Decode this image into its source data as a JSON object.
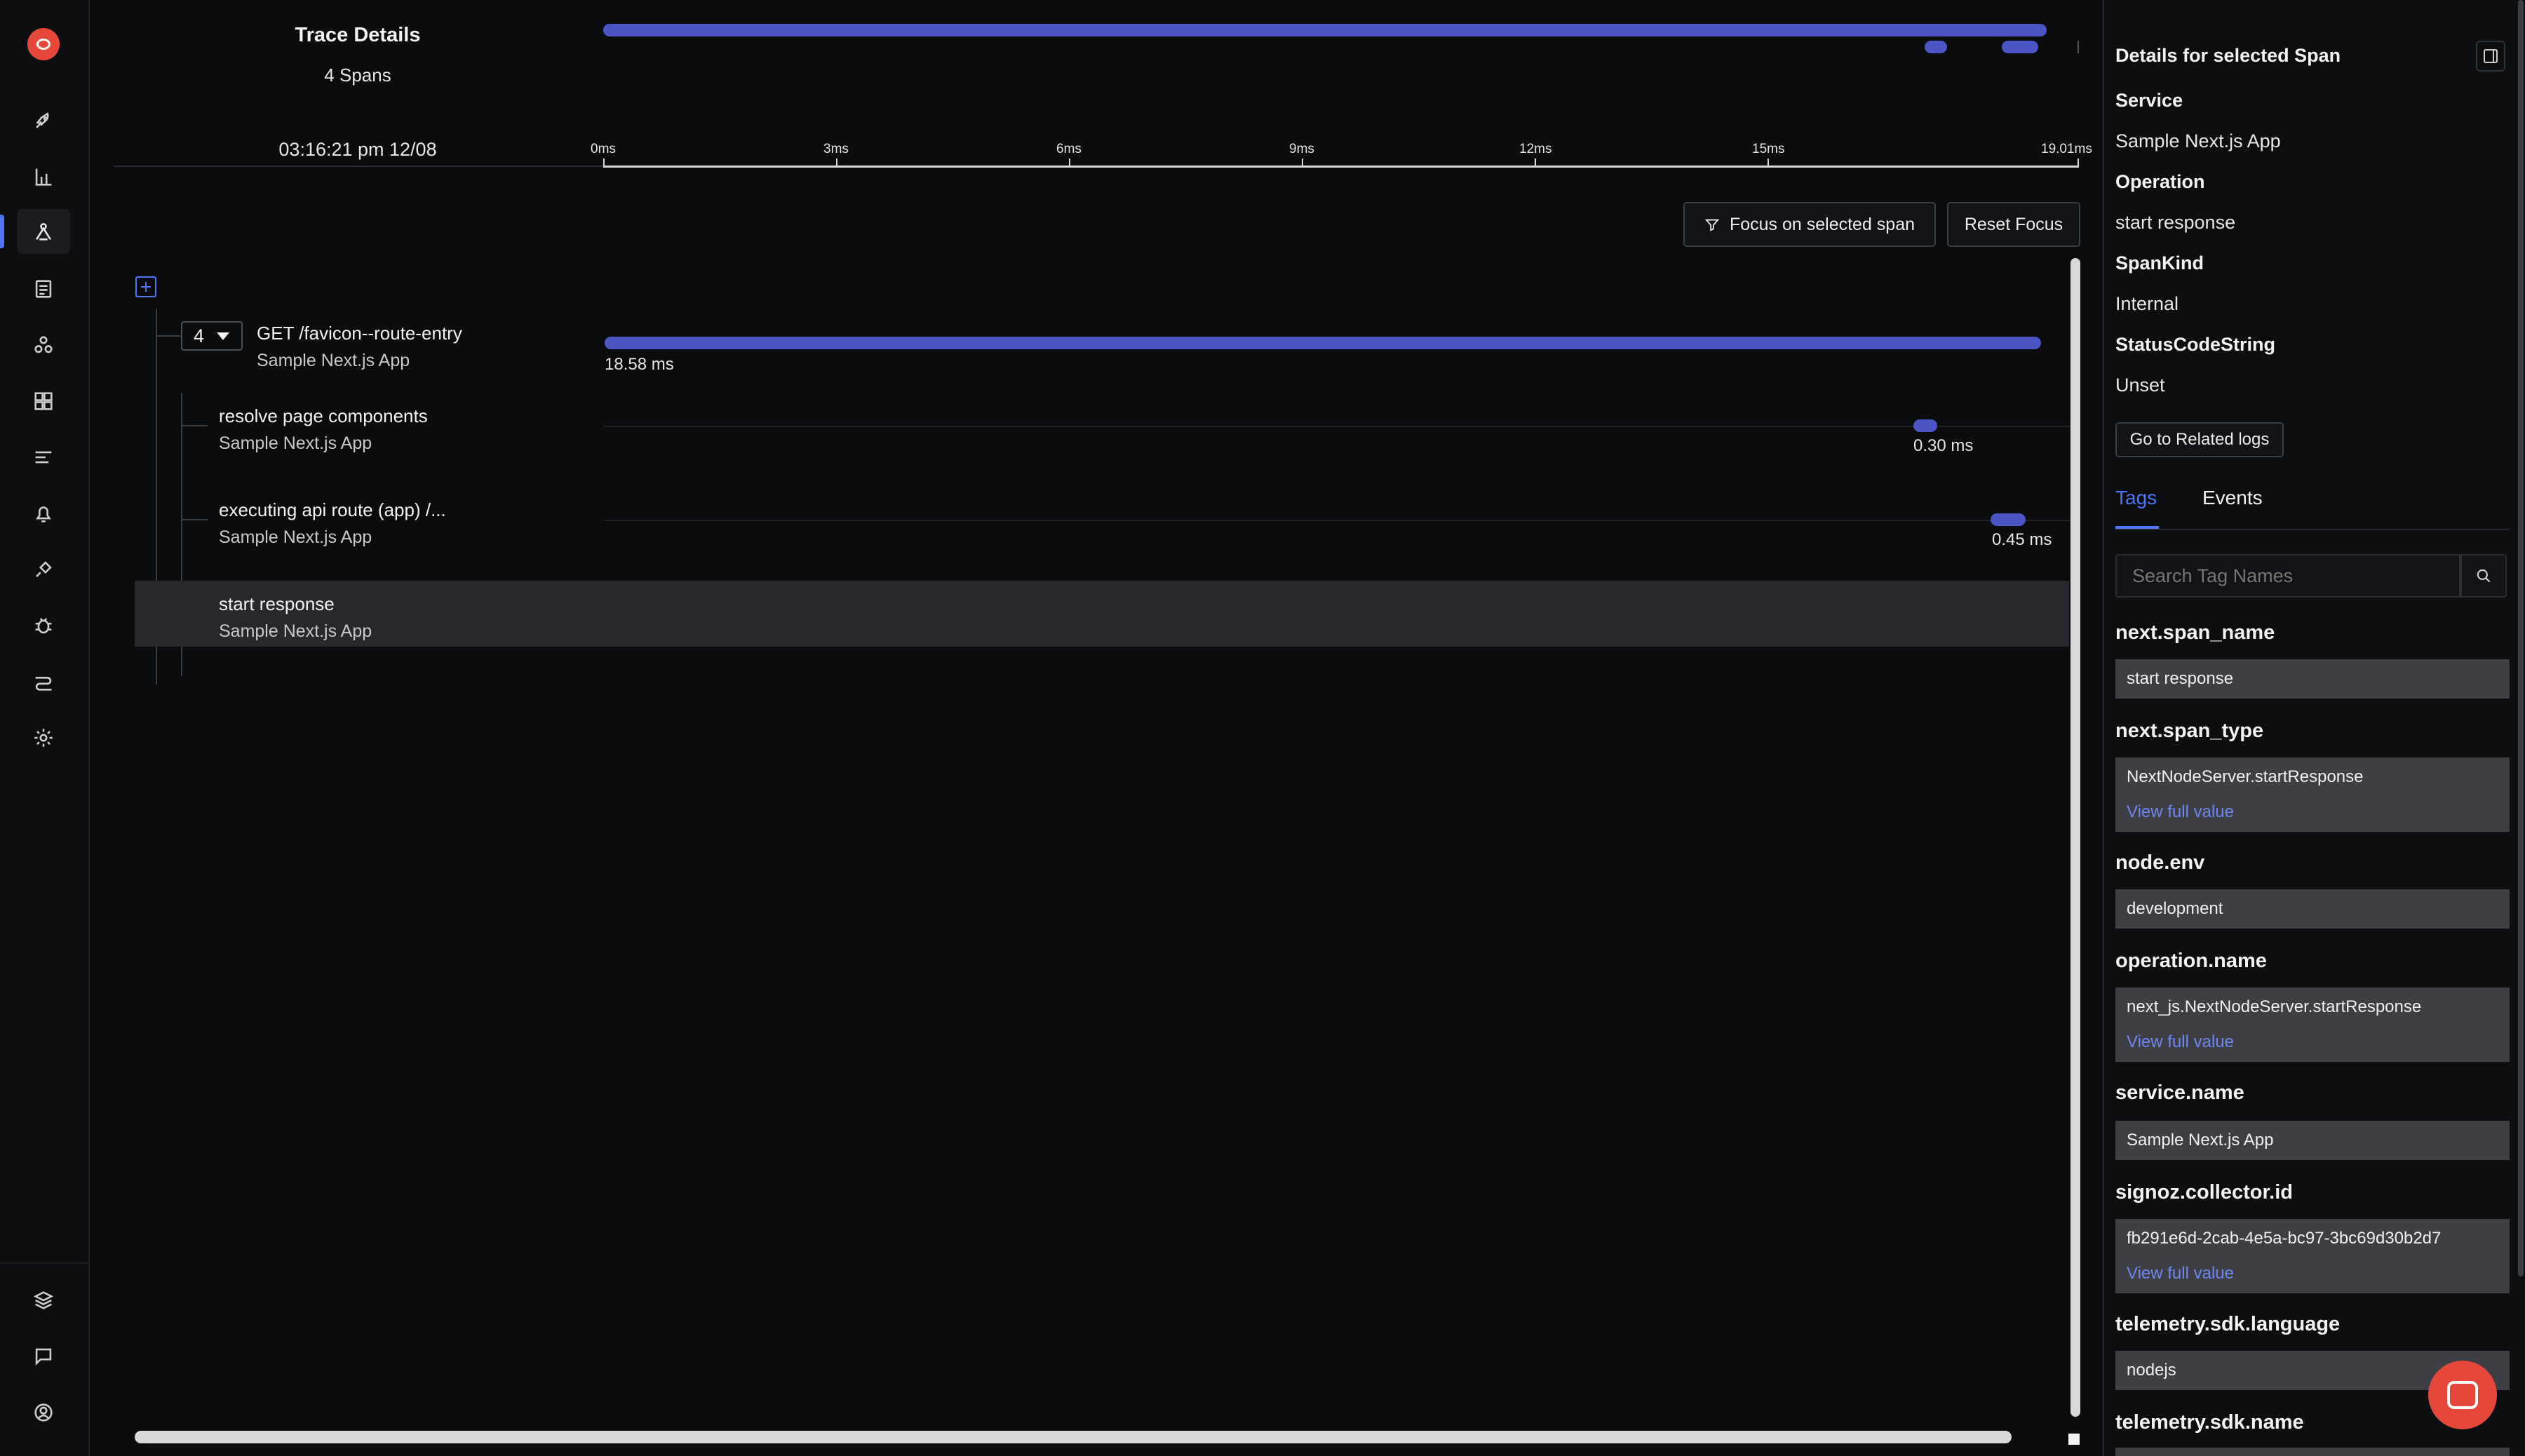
{
  "trace": {
    "title": "Trace Details",
    "span_count": "4 Spans",
    "timestamp": "03:16:21 pm 12/08",
    "ticks": [
      "0ms",
      "3ms",
      "6ms",
      "9ms",
      "12ms",
      "15ms",
      "19.01ms"
    ]
  },
  "controls": {
    "focus_label": "Focus on selected span",
    "reset_label": "Reset Focus"
  },
  "tree": {
    "child_count": "4",
    "spans": [
      {
        "name": "GET /favicon--route-entry",
        "service": "Sample Next.js App",
        "duration": "18.58 ms"
      },
      {
        "name": "resolve page components",
        "service": "Sample Next.js App",
        "duration": "0.30 ms"
      },
      {
        "name": "executing api route (app) /...",
        "service": "Sample Next.js App",
        "duration": "0.45 ms"
      },
      {
        "name": "start response",
        "service": "Sample Next.js App",
        "duration": ""
      }
    ]
  },
  "details": {
    "heading": "Details for selected Span",
    "fields": [
      {
        "label": "Service",
        "value": "Sample Next.js App"
      },
      {
        "label": "Operation",
        "value": "start response"
      },
      {
        "label": "SpanKind",
        "value": "Internal"
      },
      {
        "label": "StatusCodeString",
        "value": "Unset"
      }
    ],
    "related_logs_label": "Go to Related logs",
    "tabs": [
      "Tags",
      "Events"
    ],
    "active_tab": "Tags",
    "search_placeholder": "Search Tag Names",
    "view_full_label": "View full value",
    "tags": [
      {
        "key": "next.span_name",
        "value": "start response"
      },
      {
        "key": "next.span_type",
        "value": "NextNodeServer.startResponse"
      },
      {
        "key": "node.env",
        "value": "development"
      },
      {
        "key": "operation.name",
        "value": "next_js.NextNodeServer.startResponse"
      },
      {
        "key": "service.name",
        "value": "Sample Next.js App"
      },
      {
        "key": "signoz.collector.id",
        "value": "fb291e6d-2cab-4e5a-bc97-3bc69d30b2d7"
      },
      {
        "key": "telemetry.sdk.language",
        "value": "nodejs"
      },
      {
        "key": "telemetry.sdk.name",
        "value": ""
      }
    ]
  },
  "nav": {
    "items": [
      "rocket-icon",
      "bar-chart-icon",
      "traces-icon",
      "logs-icon",
      "service-map-icon",
      "dashboard-icon",
      "pipelines-icon",
      "alerts-icon",
      "integrations-icon",
      "bug-icon",
      "usage-icon",
      "settings-icon"
    ],
    "bottom": [
      "layers-icon",
      "chat-icon",
      "user-icon"
    ]
  },
  "colors": {
    "accent": "#4e74f8",
    "span_bar": "#4b56c4",
    "brand": "#e5483a",
    "selected_row": "#26282d"
  }
}
